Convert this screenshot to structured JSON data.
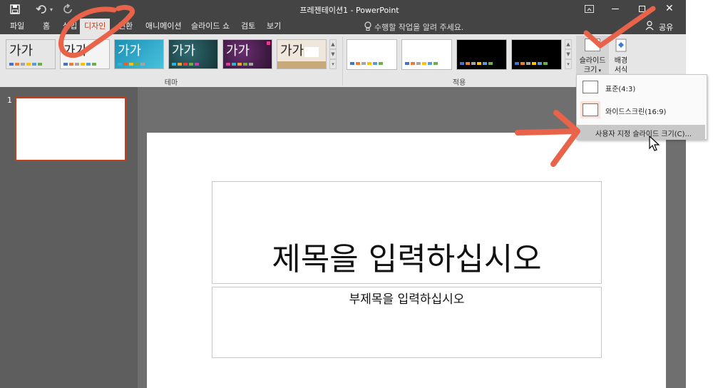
{
  "window": {
    "title": "프레젠테이션1 - PowerPoint",
    "share_label": "공유"
  },
  "tabs": [
    {
      "label": "파일"
    },
    {
      "label": "홈"
    },
    {
      "label": "삽입"
    },
    {
      "label": "디자인",
      "active": true
    },
    {
      "label": "전환"
    },
    {
      "label": "애니메이션"
    },
    {
      "label": "슬라이드 쇼"
    },
    {
      "label": "검토"
    },
    {
      "label": "보기"
    }
  ],
  "search": {
    "placeholder": "수행할 작업을 알려 주세요."
  },
  "ribbon": {
    "themes": [
      {
        "sample": "가가",
        "bg": "#ffffff",
        "fg": "#000000"
      },
      {
        "sample": "가가",
        "bg": "#f4f4f4",
        "fg": "#000000"
      },
      {
        "sample": "가가",
        "bg": "#2aa6c9",
        "fg": "#ffffff"
      },
      {
        "sample": "가가",
        "bg": "#1e4a4f",
        "fg": "#ffffff"
      },
      {
        "sample": "가가",
        "bg": "#4a1f4f",
        "fg": "#ffffff"
      },
      {
        "sample": "가가",
        "bg": "#efe6dc",
        "fg": "#000000"
      }
    ],
    "group_theme_label": "테마",
    "group_variants_label": "적용",
    "slide_size_label_line1": "슬라이드",
    "slide_size_label_line2": "크기",
    "background_label_line1": "배경",
    "background_label_line2": "서식"
  },
  "slide_size_menu": {
    "items": [
      {
        "label": "표준(4:3)"
      },
      {
        "label": "와이드스크린(16:9)"
      },
      {
        "label": "사용자 지정 슬라이드 크기(C)..."
      }
    ]
  },
  "thumbnails": [
    {
      "number": "1"
    }
  ],
  "slide": {
    "title_placeholder": "제목을 입력하십시오",
    "subtitle_placeholder": "부제목을 입력하십시오"
  },
  "colors": {
    "accent": "#c43e1c",
    "annotation": "#e8634a",
    "chrome": "#444444"
  }
}
